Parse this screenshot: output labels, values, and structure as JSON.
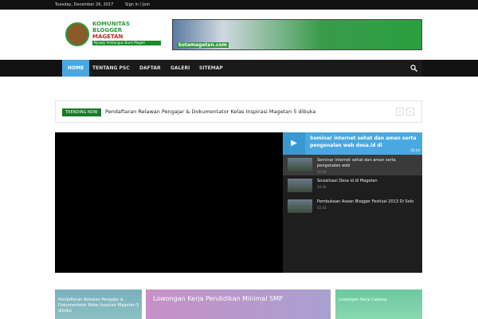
{
  "topbar": {
    "date": "Tuesday, December 26, 2017",
    "signin": "Sign in / Join"
  },
  "logo": {
    "line1": "KOMUNITAS",
    "line2": "BLOGGER",
    "line3": "MAGETAN",
    "tagline": "Nyawiji Ambangun Bumi Mageti"
  },
  "banner": {
    "text": "kotamagetan.com"
  },
  "nav": {
    "items": [
      "HOME",
      "TENTANG PSC",
      "DAFTAR",
      "GALERI",
      "SITEMAP"
    ]
  },
  "trending": {
    "label": "TRENDING NOW",
    "text": "Pendaftaran Relawan Pengajar & Dokumentator Kelas Inspirasi Magetan 5 dibuka"
  },
  "playlist": {
    "current_title": "Seminar internet sehat dan aman serta pengenalan web desa.id di",
    "current_duration": "02:44",
    "items": [
      {
        "title": "Seminar internet sehat dan aman serta pengenalan web",
        "duration": "02:44"
      },
      {
        "title": "Sosialisasi Desa id di Magetan",
        "duration": "04:40"
      },
      {
        "title": "Pembukaan Asean Blogger Festival 2013 Di Solo",
        "duration": "02:42"
      }
    ]
  },
  "cards": [
    {
      "title": "Pendaftaran Relawan Pengajar & Dokumentator Kelas Inspirasi Magetan 5 dibuka"
    },
    {
      "title": "Lowongan Kerja Pendidikan Minimal SMP"
    },
    {
      "title": "Lowongan Kerja Cabang"
    }
  ]
}
